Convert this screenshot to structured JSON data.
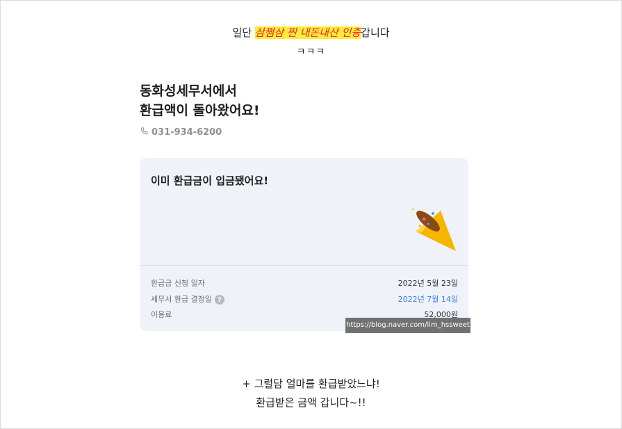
{
  "caption_top": {
    "prefix": "일단 ",
    "highlight": "삼쩜삼 찐 내돈내산 인증",
    "suffix": "갑니다",
    "line2": "ㅋㅋㅋ"
  },
  "office": {
    "line1": "동화성세무서에서",
    "line2": "환급액이 돌아왔어요!",
    "phone": "031-934-6200"
  },
  "card": {
    "headline": "이미 환급금이 입금됐어요!",
    "rows": [
      {
        "label": "환급금 신청 일자",
        "value": "2022년 5월 23일"
      },
      {
        "label": "세무서 환급 결정일",
        "value": "2022년 7월 14일",
        "help": "?"
      },
      {
        "label": "이용료",
        "value": "52,000원"
      }
    ]
  },
  "watermark": "https://blog.naver.com/lim_hssweet",
  "caption_bottom": {
    "line1": "+ 그럴담 얼마를 환급받았느냐!",
    "line2": "환급받은 금액 갑니다~!!"
  },
  "colors": {
    "highlight_bg": "#ffec3a",
    "highlight_text": "#e8262d",
    "card_bg": "#eff2f8",
    "accent_blue": "#3b82e0"
  },
  "icons": {
    "phone": "phone-icon",
    "party": "party-popper-icon",
    "help": "question-icon"
  }
}
